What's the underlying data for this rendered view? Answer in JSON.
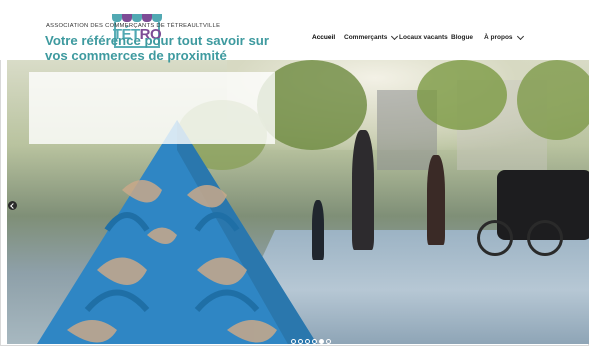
{
  "logo": {
    "text_part_a": "TÉT",
    "text_part_b": "RO",
    "awning_colors": [
      "#52a9b3",
      "#7d4c95",
      "#52a9b3",
      "#7d4c95",
      "#52a9b3"
    ],
    "brand_teal": "#52a9b3",
    "brand_purple": "#7d4c95"
  },
  "nav": {
    "items": [
      {
        "label": "Accueil",
        "active": true,
        "has_dropdown": false
      },
      {
        "label": "Commerçants",
        "active": false,
        "has_dropdown": true
      },
      {
        "label": "Locaux vacants",
        "active": false,
        "has_dropdown": false
      },
      {
        "label": "Blogue",
        "active": false,
        "has_dropdown": false
      },
      {
        "label": "À propos",
        "active": false,
        "has_dropdown": true
      }
    ]
  },
  "hero": {
    "kicker": "ASSOCIATION DES COMMERÇANTS DE TÉTREAULTVILLE",
    "title": "Votre référence pour tout savoir sur vos commerces de proximité",
    "title_color": "#3e9a9f",
    "prev_icon": "chevron-left-icon",
    "slides_count": 6,
    "active_slide": 4
  }
}
